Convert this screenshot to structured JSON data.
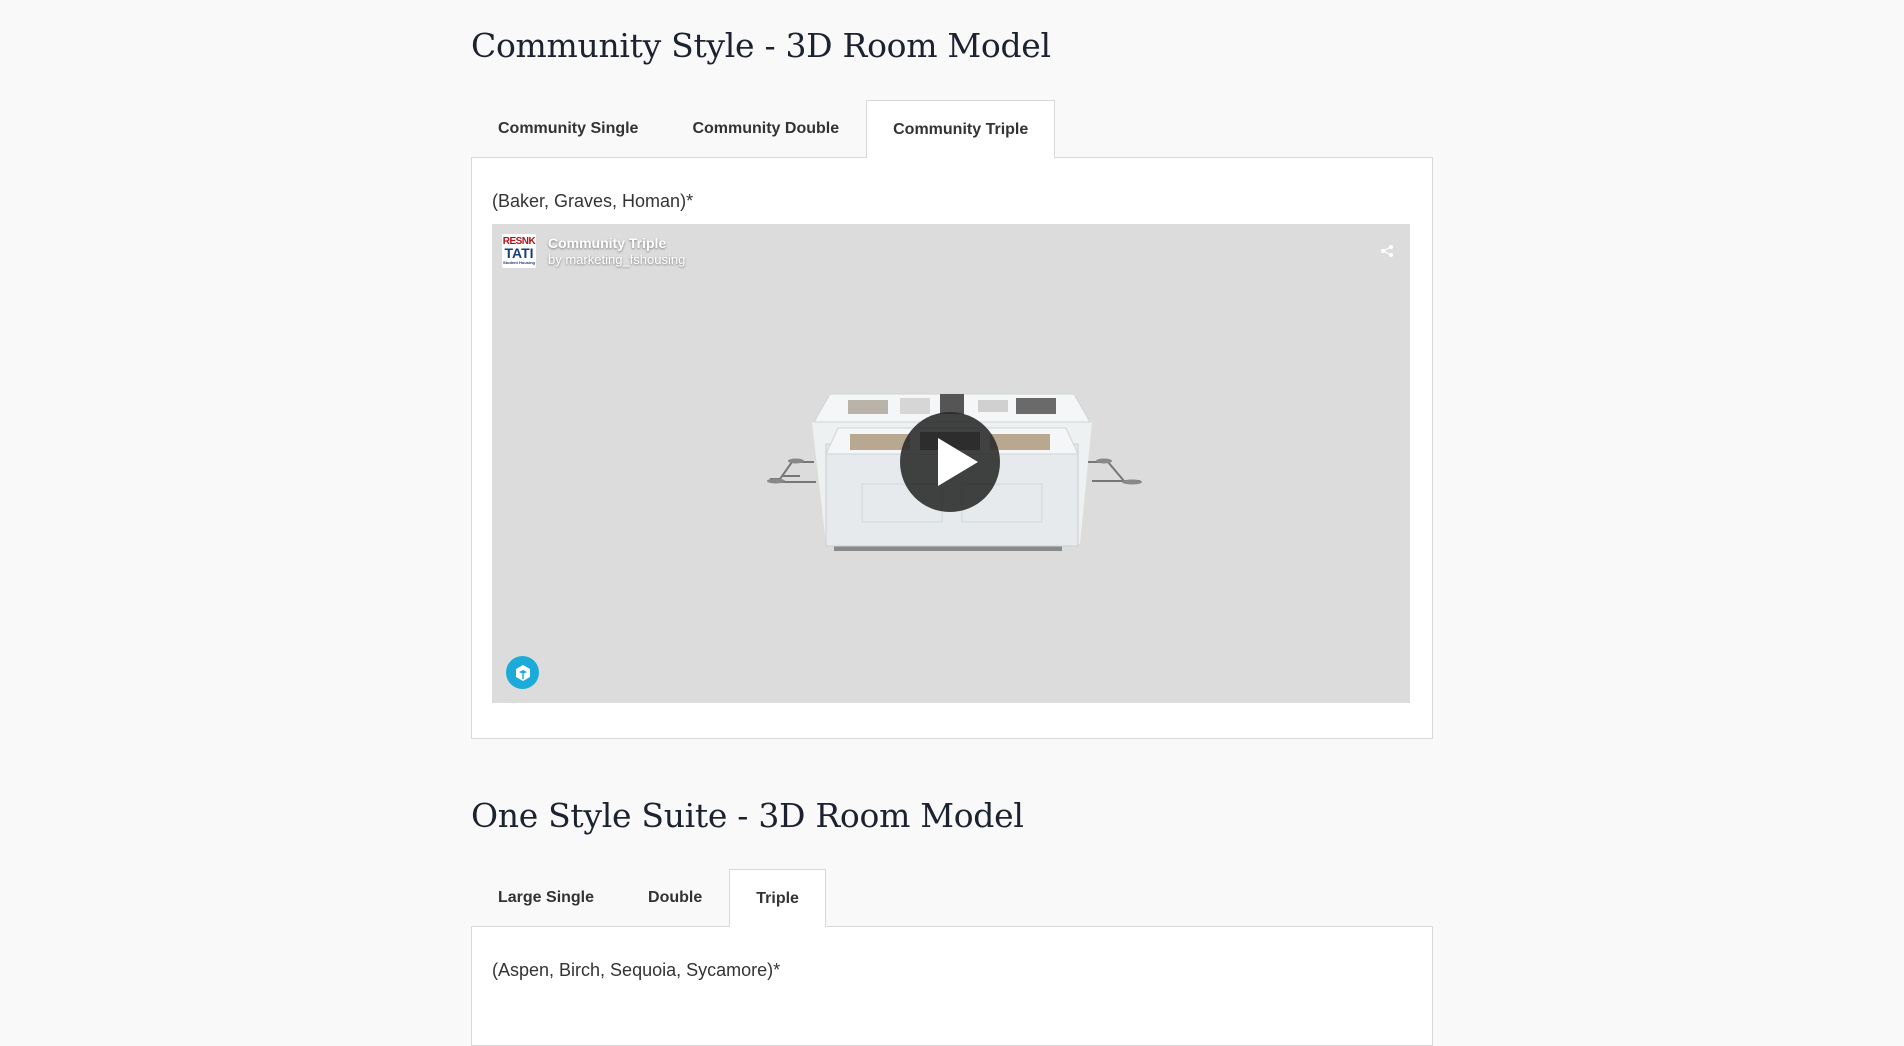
{
  "section1": {
    "title": "Community Style - 3D Room Model",
    "tabs": [
      {
        "label": "Community Single",
        "active": false
      },
      {
        "label": "Community Double",
        "active": false
      },
      {
        "label": "Community Triple",
        "active": true
      }
    ],
    "note": "(Baker, Graves, Homan)*",
    "viewer": {
      "logo_top": "RESNK",
      "logo_mid": "TATI",
      "logo_bottom": "Student Housing",
      "model_title": "Community Triple",
      "model_author": "by marketing_fshousing",
      "share_icon": "share-icon",
      "play_icon": "play-icon",
      "brand_icon": "sketchfab-icon",
      "brand_color": "#1caad9"
    }
  },
  "section2": {
    "title": "One Style Suite - 3D Room Model",
    "tabs": [
      {
        "label": "Large Single",
        "active": false
      },
      {
        "label": "Double",
        "active": false
      },
      {
        "label": "Triple",
        "active": true
      }
    ],
    "note": "(Aspen, Birch, Sequoia, Sycamore)*"
  }
}
